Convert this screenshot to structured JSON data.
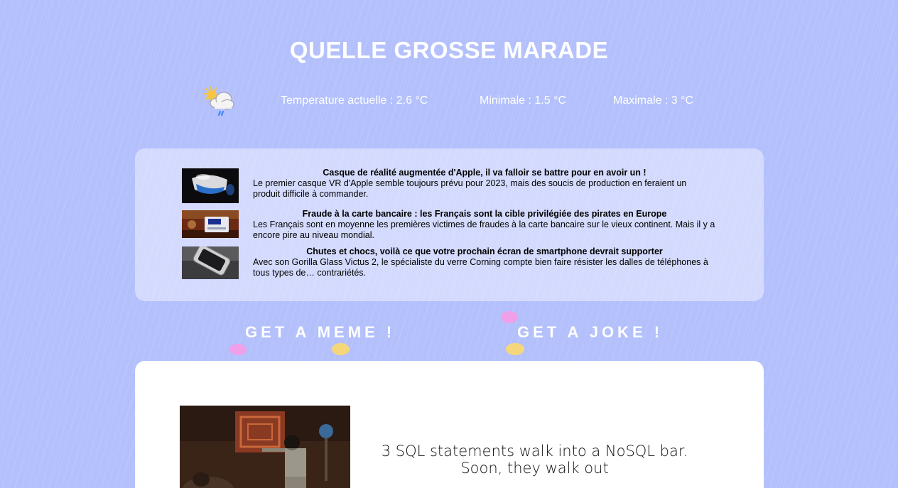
{
  "site": {
    "title": "QUELLE GROSSE MARADE"
  },
  "weather": {
    "icon": "sun-cloud-rain-icon",
    "current": "Temperature actuelle : 2.6 °C",
    "min": "Minimale : 1.5 °C",
    "max": "Maximale : 3 °C"
  },
  "news": [
    {
      "thumb": "vr-headset-image",
      "title": "Casque de réalité augmentée d'Apple, il va falloir se battre pour en avoir un !",
      "summary": "Le premier casque VR d'Apple semble toujours prévu pour 2023, mais des soucis de production en feraient un produit difficile à commander."
    },
    {
      "thumb": "credit-card-image",
      "title": "Fraude à la carte bancaire : les Français sont la cible privilégiée des pirates en Europe",
      "summary": "Les Français sont en moyenne les premières victimes de fraudes à la carte bancaire sur le vieux continent. Mais il y a encore pire au niveau mondial."
    },
    {
      "thumb": "smartphone-image",
      "title": "Chutes et chocs, voilà ce que votre prochain écran de smartphone devrait supporter",
      "summary": "Avec son Gorilla Glass Victus 2, le spécialiste du verre Corning compte bien faire résister les dalles de téléphones à tous types de… contrariétés."
    }
  ],
  "buttons": {
    "meme": "GET A MEME !",
    "joke": "GET A JOKE !"
  },
  "content": {
    "joke": "3 SQL statements walk into a NoSQL bar. Soon, they walk out"
  },
  "colors": {
    "background": "#b3c0fb",
    "dot_pink": "#f0a0e8",
    "dot_yellow": "#f5d67a"
  }
}
